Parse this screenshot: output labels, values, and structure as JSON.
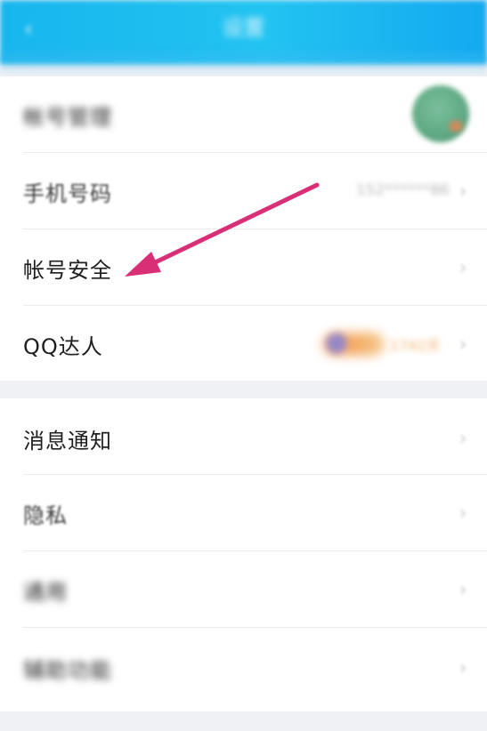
{
  "header": {
    "title": "设置",
    "back_glyph": "‹",
    "back_icon": "back-arrow-icon",
    "gradient": [
      "#17b6ee",
      "#22c3f1",
      "#13a9f0"
    ]
  },
  "group1": {
    "rows": [
      {
        "label": "帐号管理",
        "trailing": "avatar",
        "chevron": "›"
      },
      {
        "label": "手机号码",
        "value": "152******86",
        "chevron": "›"
      },
      {
        "label": "帐号安全",
        "chevron": "›"
      },
      {
        "label": "QQ达人",
        "badge_text": "1742天",
        "chevron": "›"
      }
    ]
  },
  "group2": {
    "rows": [
      {
        "label": "消息通知",
        "chevron": "›"
      },
      {
        "label": "隐私",
        "chevron": "›"
      },
      {
        "label": "通用",
        "chevron": "›"
      },
      {
        "label": "辅助功能",
        "chevron": "›"
      }
    ]
  },
  "annotation": {
    "color": "#d92f77",
    "icon": "annotation-arrow-icon"
  }
}
